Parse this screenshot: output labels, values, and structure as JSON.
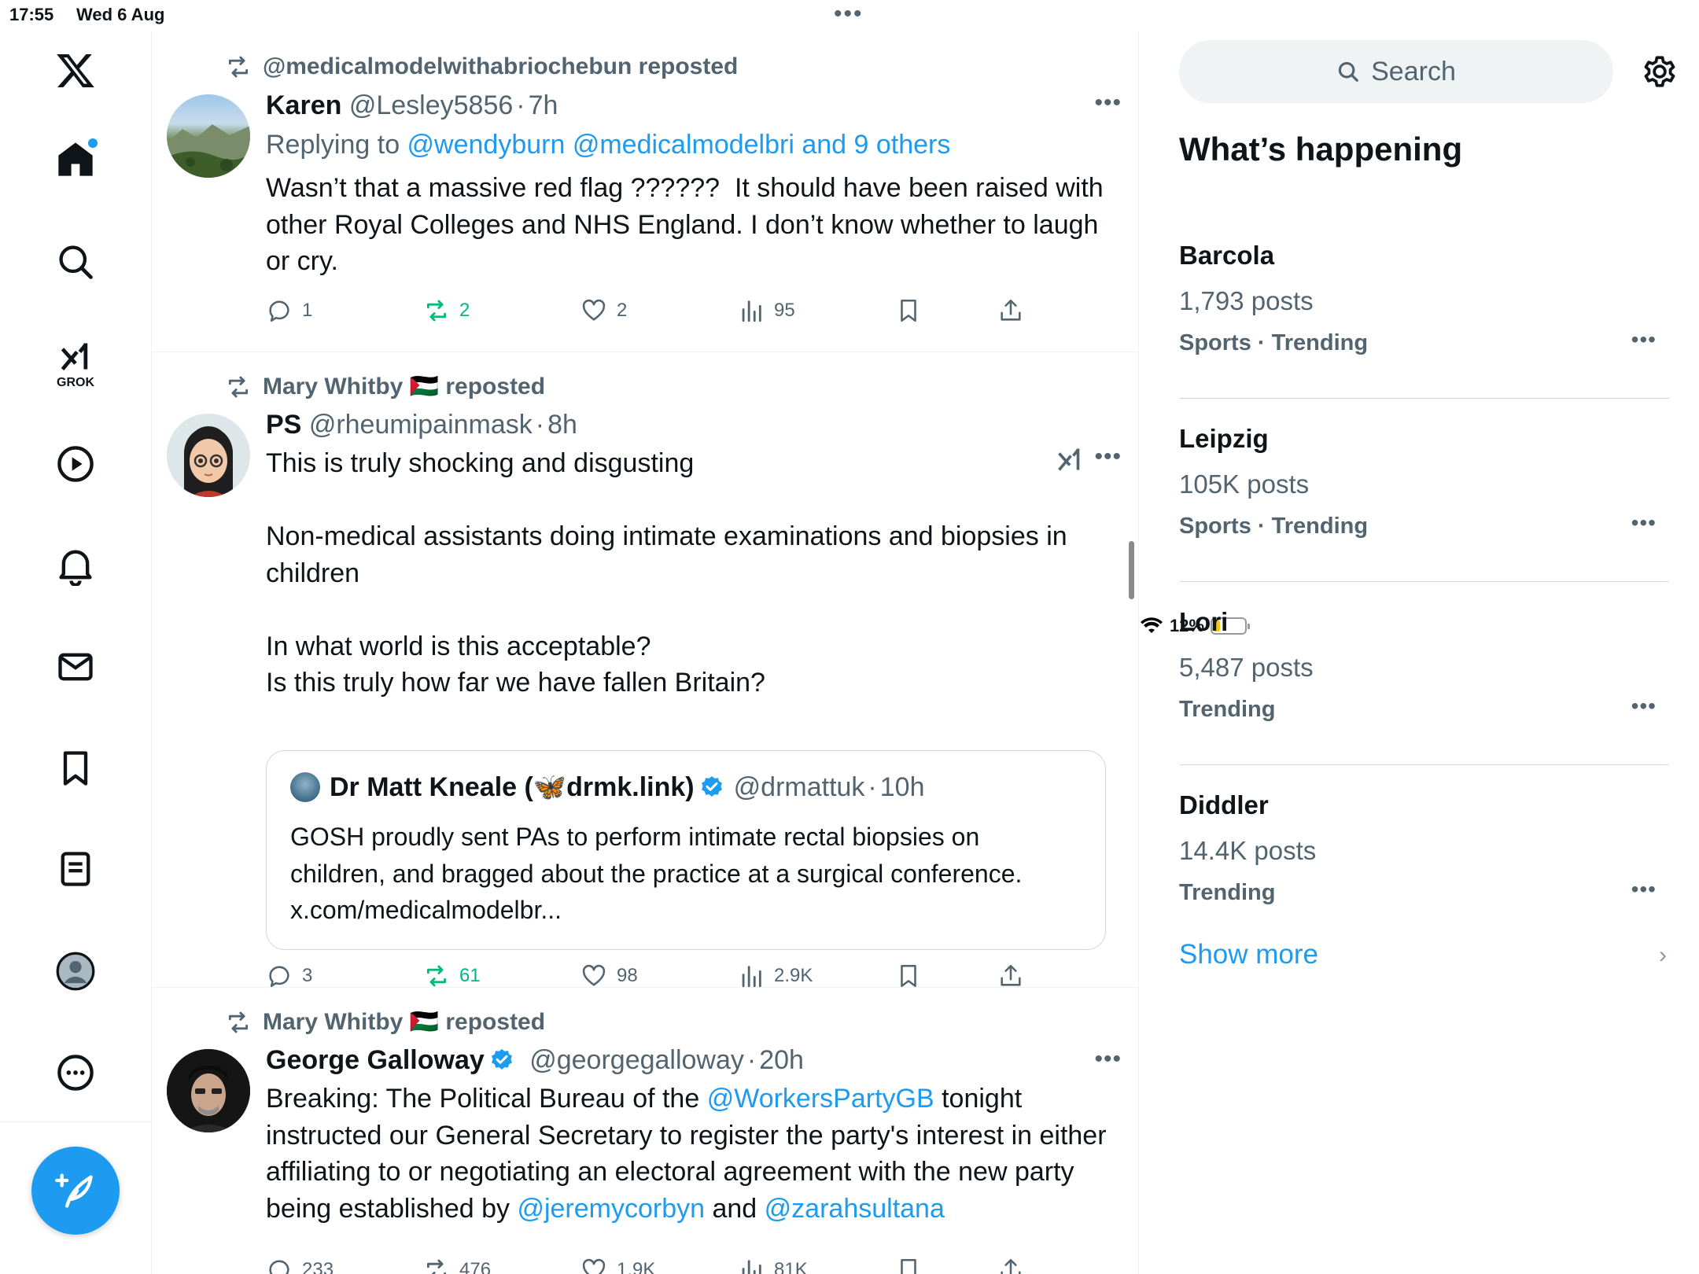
{
  "status_bar": {
    "time": "17:55",
    "date": "Wed 6 Aug",
    "battery": "12%"
  },
  "nav": {
    "grok_label": "GROK"
  },
  "tweets": [
    {
      "reposted_by": "@medicalmodelwithabriochebun reposted",
      "name": "Karen",
      "handle": "@Lesley5856",
      "time": "7h",
      "replying_prefix": "Replying to ",
      "replying_links": "@wendyburn @medicalmodelbri and 9 others",
      "text": "Wasn’t that a massive red flag ??????  It should have been raised with other Royal Colleges and NHS England. I don’t know whether to laugh or cry.",
      "replies": "1",
      "reposts": "2",
      "likes": "2",
      "views": "95"
    },
    {
      "reposted_by": "Mary Whitby 🇵🇸 reposted",
      "name": "PS",
      "handle": "@rheumipainmask",
      "time": "8h",
      "text": "This is truly shocking and disgusting\n\nNon-medical assistants doing intimate examinations and biopsies in children\n\nIn what world is this acceptable?\nIs this truly how far we have fallen Britain?",
      "quote": {
        "name": "Dr Matt Kneale (🦋drmk.link)",
        "handle": "@drmattuk",
        "time": "10h",
        "text": "GOSH proudly sent PAs to perform intimate rectal biopsies on children, and bragged about the practice at a surgical conference. x.com/medicalmodelbr..."
      },
      "replies": "3",
      "reposts": "61",
      "likes": "98",
      "views": "2.9K"
    },
    {
      "reposted_by": "Mary Whitby 🇵🇸 reposted",
      "name": "George Galloway",
      "handle": "@georgegalloway",
      "time": "20h",
      "text_1": "Breaking: The Political Bureau of the ",
      "link_1": "@WorkersPartyGB",
      "text_2": " tonight instructed our General Secretary to register the party's interest in either affiliating to or negotiating an electoral agreement with the new party being established by ",
      "link_2": "@jeremycorbyn",
      "text_3": " and ",
      "link_3": "@zarahsultana",
      "replies": "233",
      "reposts": "476",
      "likes": "1.9K",
      "views": "81K"
    }
  ],
  "sidebar": {
    "search_placeholder": "Search",
    "title": "What’s happening",
    "trends": [
      {
        "name": "Barcola",
        "count": "1,793 posts",
        "category": "Sports · Trending"
      },
      {
        "name": "Leipzig",
        "count": "105K posts",
        "category": "Sports · Trending"
      },
      {
        "name": "Lori",
        "count": "5,487 posts",
        "category": "Trending"
      },
      {
        "name": "Diddler",
        "count": "14.4K posts",
        "category": "Trending"
      }
    ],
    "show_more": "Show more"
  },
  "colors": {
    "accent": "#1d9bf0",
    "text": "#0f1419",
    "secondary": "#536471",
    "repost_active": "#00ba7c"
  }
}
